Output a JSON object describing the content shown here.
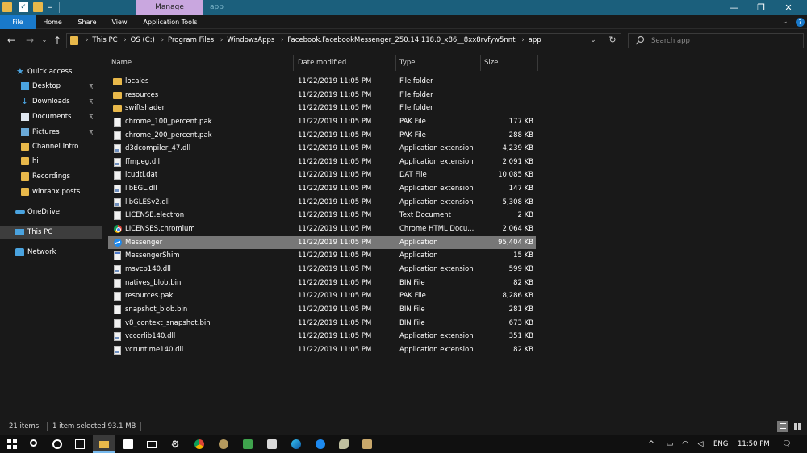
{
  "titlebar": {
    "manage_tab": "Manage",
    "title": "app",
    "minimize_glyph": "—",
    "maximize_glyph": "❐",
    "close_glyph": "✕"
  },
  "ribbon": {
    "tabs": [
      {
        "label": "File"
      },
      {
        "label": "Home"
      },
      {
        "label": "Share"
      },
      {
        "label": "View"
      },
      {
        "label": "Application Tools"
      }
    ],
    "collapse_glyph": "⌄",
    "help_glyph": "?"
  },
  "nav": {
    "back_glyph": "←",
    "forward_glyph": "→",
    "recent_glyph": "⌄",
    "up_glyph": "↑",
    "dropdown_glyph": "⌄",
    "refresh_glyph": "↻"
  },
  "address": {
    "crumbs": [
      "This PC",
      "OS (C:)",
      "Program Files",
      "WindowsApps",
      "Facebook.FacebookMessenger_250.14.118.0_x86__8xx8rvfyw5nnt",
      "app"
    ],
    "separator": "›"
  },
  "search": {
    "placeholder": "Search app"
  },
  "sidebar": {
    "items": [
      {
        "label": "Quick access",
        "icon": "star-icon"
      },
      {
        "label": "Desktop",
        "icon": "desktop-icon",
        "pinned": true
      },
      {
        "label": "Downloads",
        "icon": "download-icon",
        "pinned": true
      },
      {
        "label": "Documents",
        "icon": "documents-icon",
        "pinned": true
      },
      {
        "label": "Pictures",
        "icon": "pictures-icon",
        "pinned": true
      },
      {
        "label": "Channel Intro",
        "icon": "folder-icon"
      },
      {
        "label": "hi",
        "icon": "folder-icon"
      },
      {
        "label": "Recordings",
        "icon": "folder-icon"
      },
      {
        "label": "winranx posts",
        "icon": "folder-icon"
      },
      {
        "label": "OneDrive",
        "icon": "cloud-icon"
      },
      {
        "label": "This PC",
        "icon": "computer-icon",
        "selected": true
      },
      {
        "label": "Network",
        "icon": "network-icon"
      }
    ],
    "pin_glyph": "📌"
  },
  "columns": {
    "name": "Name",
    "date": "Date modified",
    "type": "Type",
    "size": "Size",
    "sort_glyph": "^"
  },
  "files": [
    {
      "name": "locales",
      "date": "11/22/2019 11:05 PM",
      "type": "File folder",
      "size": "",
      "icon": "folder"
    },
    {
      "name": "resources",
      "date": "11/22/2019 11:05 PM",
      "type": "File folder",
      "size": "",
      "icon": "folder"
    },
    {
      "name": "swiftshader",
      "date": "11/22/2019 11:05 PM",
      "type": "File folder",
      "size": "",
      "icon": "folder"
    },
    {
      "name": "chrome_100_percent.pak",
      "date": "11/22/2019 11:05 PM",
      "type": "PAK File",
      "size": "177 KB",
      "icon": "doc"
    },
    {
      "name": "chrome_200_percent.pak",
      "date": "11/22/2019 11:05 PM",
      "type": "PAK File",
      "size": "288 KB",
      "icon": "doc"
    },
    {
      "name": "d3dcompiler_47.dll",
      "date": "11/22/2019 11:05 PM",
      "type": "Application extension",
      "size": "4,239 KB",
      "icon": "dll"
    },
    {
      "name": "ffmpeg.dll",
      "date": "11/22/2019 11:05 PM",
      "type": "Application extension",
      "size": "2,091 KB",
      "icon": "dll"
    },
    {
      "name": "icudtl.dat",
      "date": "11/22/2019 11:05 PM",
      "type": "DAT File",
      "size": "10,085 KB",
      "icon": "doc"
    },
    {
      "name": "libEGL.dll",
      "date": "11/22/2019 11:05 PM",
      "type": "Application extension",
      "size": "147 KB",
      "icon": "dll"
    },
    {
      "name": "libGLESv2.dll",
      "date": "11/22/2019 11:05 PM",
      "type": "Application extension",
      "size": "5,308 KB",
      "icon": "dll"
    },
    {
      "name": "LICENSE.electron",
      "date": "11/22/2019 11:05 PM",
      "type": "Text Document",
      "size": "2 KB",
      "icon": "doc"
    },
    {
      "name": "LICENSES.chromium",
      "date": "11/22/2019 11:05 PM",
      "type": "Chrome HTML Docu...",
      "size": "2,064 KB",
      "icon": "chrome"
    },
    {
      "name": "Messenger",
      "date": "11/22/2019 11:05 PM",
      "type": "Application",
      "size": "95,404 KB",
      "icon": "messenger",
      "selected": true
    },
    {
      "name": "MessengerShim",
      "date": "11/22/2019 11:05 PM",
      "type": "Application",
      "size": "15 KB",
      "icon": "app"
    },
    {
      "name": "msvcp140.dll",
      "date": "11/22/2019 11:05 PM",
      "type": "Application extension",
      "size": "599 KB",
      "icon": "dll"
    },
    {
      "name": "natives_blob.bin",
      "date": "11/22/2019 11:05 PM",
      "type": "BIN File",
      "size": "82 KB",
      "icon": "doc"
    },
    {
      "name": "resources.pak",
      "date": "11/22/2019 11:05 PM",
      "type": "PAK File",
      "size": "8,286 KB",
      "icon": "doc"
    },
    {
      "name": "snapshot_blob.bin",
      "date": "11/22/2019 11:05 PM",
      "type": "BIN File",
      "size": "281 KB",
      "icon": "doc"
    },
    {
      "name": "v8_context_snapshot.bin",
      "date": "11/22/2019 11:05 PM",
      "type": "BIN File",
      "size": "673 KB",
      "icon": "doc"
    },
    {
      "name": "vccorlib140.dll",
      "date": "11/22/2019 11:05 PM",
      "type": "Application extension",
      "size": "351 KB",
      "icon": "dll"
    },
    {
      "name": "vcruntime140.dll",
      "date": "11/22/2019 11:05 PM",
      "type": "Application extension",
      "size": "82 KB",
      "icon": "dll"
    }
  ],
  "status": {
    "item_count": "21 items",
    "selection": "1 item selected  93.1 MB"
  },
  "taskbar": {
    "apps": [
      {
        "name": "start",
        "active": false
      },
      {
        "name": "search",
        "active": false
      },
      {
        "name": "cortana",
        "active": false
      },
      {
        "name": "task-view",
        "active": false
      },
      {
        "name": "file-explorer",
        "active": true
      },
      {
        "name": "store",
        "active": false
      },
      {
        "name": "mail",
        "active": false
      },
      {
        "name": "settings",
        "active": false
      },
      {
        "name": "chrome",
        "active": false
      },
      {
        "name": "app-1",
        "active": false
      },
      {
        "name": "camtasia",
        "active": false
      },
      {
        "name": "app-2",
        "active": false
      },
      {
        "name": "edge",
        "active": false
      },
      {
        "name": "messenger",
        "active": false
      },
      {
        "name": "app-3",
        "active": false
      },
      {
        "name": "app-4",
        "active": false
      }
    ],
    "tray": {
      "chevron": "^",
      "language": "ENG",
      "time": "11:50 PM",
      "notification_glyph": "🗨"
    }
  },
  "colors": {
    "titlebar": "#1b5f7c",
    "manage_tab": "#c9a7df",
    "file_tab": "#1979ca",
    "selected_row": "#777777",
    "background": "#191919",
    "taskbar": "#101010"
  }
}
